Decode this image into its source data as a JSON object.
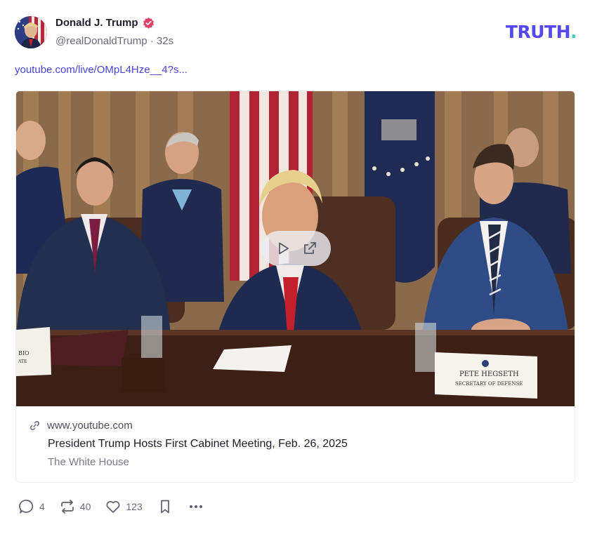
{
  "post": {
    "author_name": "Donald J. Trump",
    "handle": "@realDonaldTrump",
    "separator": "·",
    "time": "32s",
    "link_text": "youtube.com/live/OMpL4Hze__4?s..."
  },
  "brand": {
    "logo_text": "TRUTH",
    "logo_dot": ".",
    "accent": "#5448ee",
    "dot_color": "#43d0c0"
  },
  "video_card": {
    "domain": "www.youtube.com",
    "title": "President Trump Hosts First Cabinet Meeting, Feb. 26, 2025",
    "source": "The White House",
    "name_placards": {
      "left_line1": "BIO",
      "left_line2": "ATE",
      "right_line1": "PETE HEGSETH",
      "right_line2": "SECRETARY OF DEFENSE"
    },
    "overlay_icons": [
      "play-icon",
      "external-link-icon"
    ]
  },
  "actions": {
    "replies": "4",
    "retruths": "40",
    "likes": "123"
  },
  "icons": {
    "verified": "verified-badge-icon",
    "reply": "reply-bubble-icon",
    "retruth": "retruth-icon",
    "like": "heart-icon",
    "bookmark": "bookmark-icon",
    "more": "more-dots-icon",
    "link": "link-icon"
  }
}
